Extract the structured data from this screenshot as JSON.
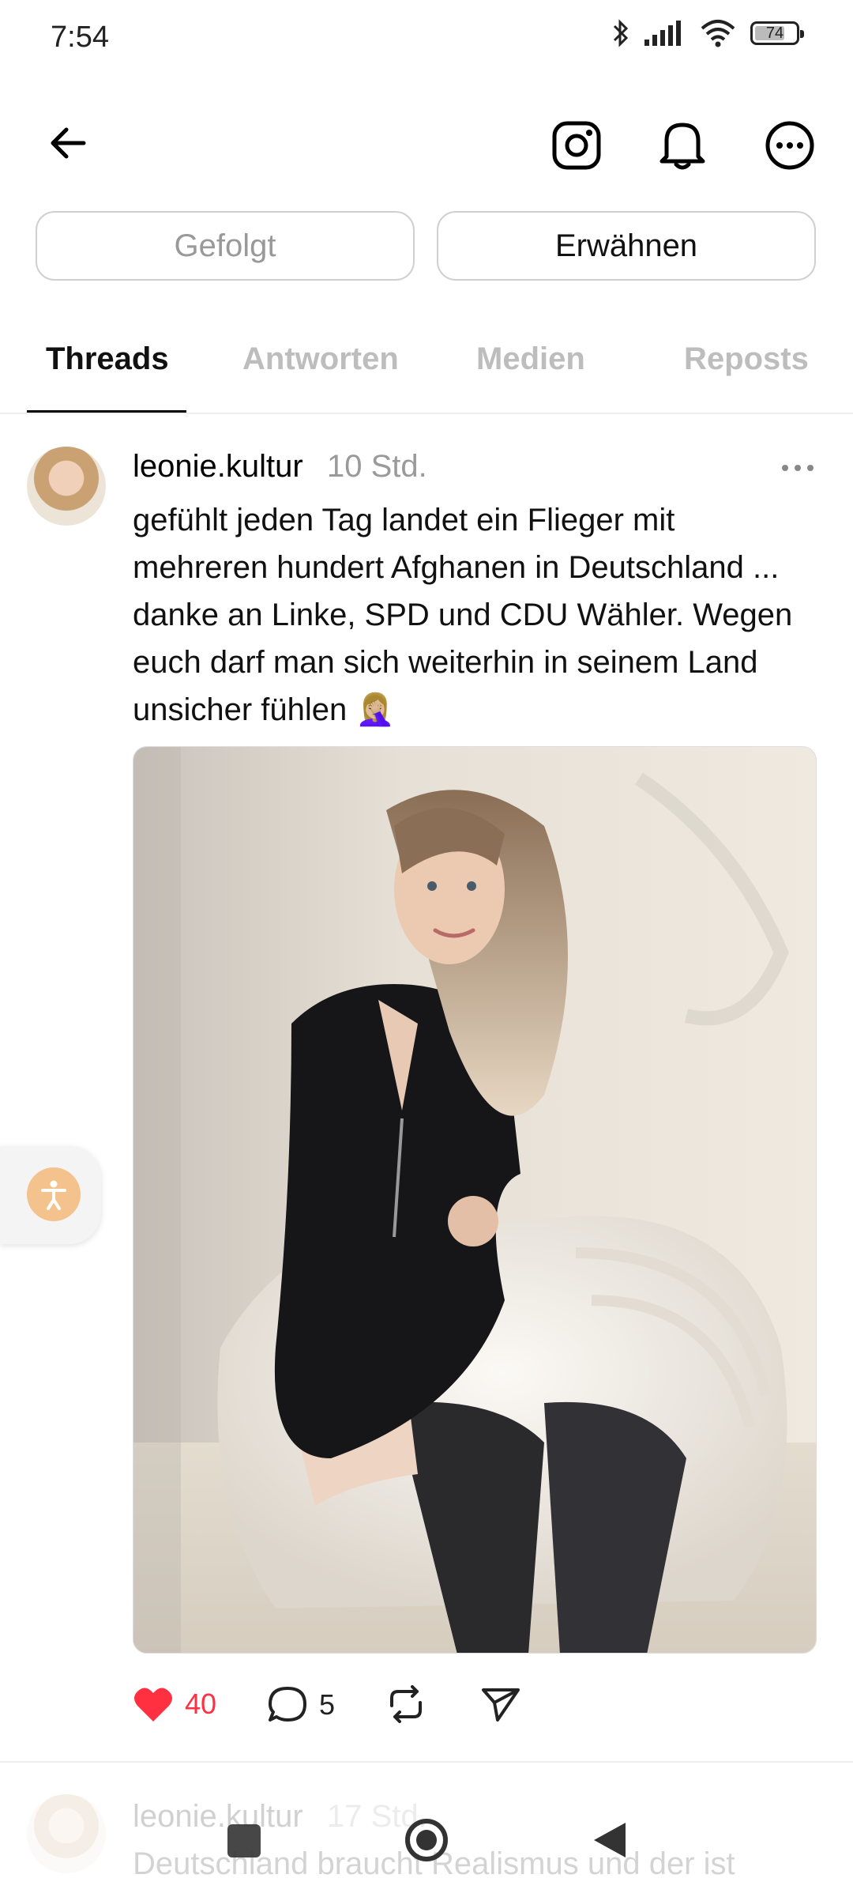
{
  "status_bar": {
    "time": "7:54",
    "battery": "74",
    "battery_level": 0.74
  },
  "header": {
    "back_icon": "arrow-left-icon",
    "instagram_icon": "instagram-icon",
    "notifications_icon": "bell-icon",
    "more_icon": "more-circle-icon",
    "followed_label": "Gefolgt",
    "mention_label": "Erwähnen"
  },
  "tabs": [
    {
      "label": "Threads",
      "active": true
    },
    {
      "label": "Antworten",
      "active": false
    },
    {
      "label": "Medien",
      "active": false
    },
    {
      "label": "Reposts",
      "active": false
    }
  ],
  "post": {
    "username": "leonie.kultur",
    "time": "10 Std.",
    "text": "gefühlt jeden Tag landet ein Flieger mit\nmehreren hundert Afghanen in Deutschland ...\ndanke an Linke, SPD und CDU Wähler. Wegen\neuch darf man sich weiterhin in seinem Land\nunsicher fühlen 🤦🏼‍♀️",
    "likes": "40",
    "comments": "5"
  },
  "next_post": {
    "username": "leonie.kultur",
    "time": "17 Std.",
    "text": "Deutschland braucht Realismus und der ist"
  },
  "colors": {
    "like": "#ff3040",
    "accessibility": "#f4c28c"
  }
}
